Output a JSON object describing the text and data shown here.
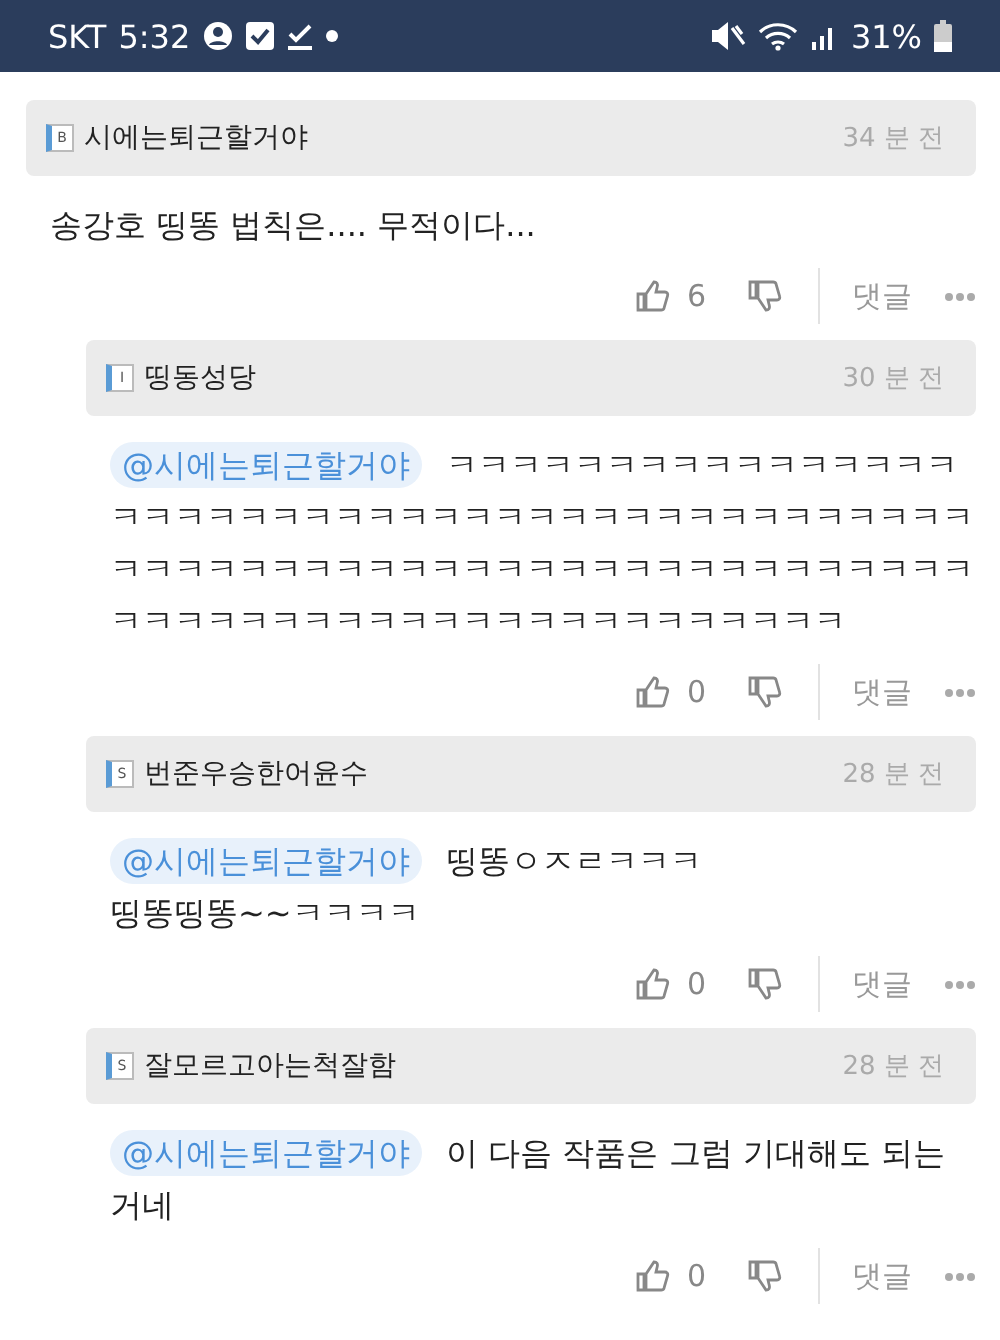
{
  "status_bar": {
    "carrier": "SKT",
    "time": "5:32",
    "battery": "31%"
  },
  "comments": [
    {
      "badge": "B",
      "author": "시에는퇴근할거야",
      "time": "34 분 전",
      "text": "송강호 띵똥 법칙은.... 무적이다...",
      "likes": "6",
      "reply_label": "댓글",
      "children": [
        {
          "badge": "I",
          "author": "띵동성당",
          "time": "30 분 전",
          "mention": "@시에는퇴근할거야",
          "text": "ㅋㅋㅋㅋㅋㅋㅋㅋㅋㅋㅋㅋㅋㅋㅋㅋㅋㅋㅋㅋㅋㅋㅋㅋㅋㅋㅋㅋㅋㅋㅋㅋㅋㅋㅋㅋㅋㅋㅋㅋㅋㅋㅋㅋㅋㅋㅋㅋㅋㅋㅋㅋㅋㅋㅋㅋㅋㅋㅋㅋㅋㅋㅋㅋㅋㅋㅋㅋㅋㅋㅋㅋㅋㅋㅋㅋㅋㅋㅋㅋㅋㅋㅋㅋㅋㅋㅋㅋㅋㅋㅋㅋㅋ",
          "likes": "0",
          "reply_label": "댓글"
        },
        {
          "badge": "S",
          "author": "번준우승한어윤수",
          "time": "28 분 전",
          "mention": "@시에는퇴근할거야",
          "text": "띵똥ㅇㅈㄹㅋㅋㅋ\n띵똥띵똥~~ㅋㅋㅋㅋ",
          "likes": "0",
          "reply_label": "댓글"
        },
        {
          "badge": "S",
          "author": "잘모르고아는척잘함",
          "time": "28 분 전",
          "mention": "@시에는퇴근할거야",
          "text": "이 다음 작품은 그럼 기대해도 되는거네",
          "likes": "0",
          "reply_label": "댓글"
        }
      ]
    }
  ]
}
